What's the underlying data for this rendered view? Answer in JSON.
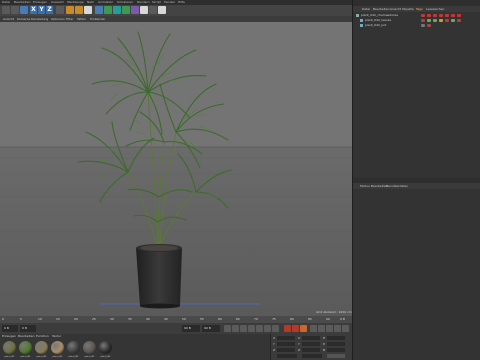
{
  "menu": [
    "Datei",
    "Bearbeiten",
    "Erzeugen",
    "Auswahl",
    "Werkzeuge",
    "Netz",
    "Animation",
    "Simulieren",
    "Rendern",
    "Skript",
    "Fenster",
    "Hilfe"
  ],
  "toolbar": {
    "axis_x": "X",
    "axis_y": "Y",
    "axis_z": "Z"
  },
  "viewport": {
    "menu": [
      "Ansicht",
      "Kameras",
      "Darstellung",
      "Optionen",
      "Filter",
      "Tafeln",
      "ProRender"
    ],
    "label": "Perspektive",
    "grid_info": "Grid Abstand : 1000 cm"
  },
  "object_manager": {
    "menu": [
      "Datei",
      "Bearbeiten",
      "Ansicht",
      "Objekte",
      "Tags",
      "Lesezeichen"
    ],
    "objects": [
      {
        "name": "plant_042_chamaedorea",
        "indent": 0
      },
      {
        "name": "plant_042_leaves",
        "indent": 1
      },
      {
        "name": "plant_042_pot",
        "indent": 1
      }
    ]
  },
  "attribute_manager": {
    "menu": [
      "Modus",
      "Bearbeiten",
      "Benutzerdaten"
    ]
  },
  "timeline": {
    "ticks": [
      "0",
      "5",
      "10",
      "15",
      "20",
      "25",
      "30",
      "35",
      "40",
      "45",
      "50",
      "55",
      "60",
      "65",
      "70",
      "75",
      "80",
      "85",
      "90"
    ],
    "current_frame": "0 B"
  },
  "transport": {
    "start_field": "0 B",
    "frame_field": "0 B",
    "end_field": "90 B",
    "end_field2": "90 B"
  },
  "materials": {
    "menu": [
      "Erzeugen",
      "Bearbeiten",
      "Funktion",
      "Textur"
    ],
    "items": [
      {
        "label": "plant_042",
        "color": "#6f7040"
      },
      {
        "label": "plant_042",
        "color": "#4f7a2a"
      },
      {
        "label": "plant_042",
        "color": "#8c7c56"
      },
      {
        "label": "plant_042",
        "color": "#a98d67"
      },
      {
        "label": "plant_042",
        "color": "#3e3e3e"
      },
      {
        "label": "plant_042",
        "color": "#5b5651"
      },
      {
        "label": "plant_042",
        "color": "#2b2b2b"
      }
    ]
  },
  "coords": {
    "rows": [
      {
        "a": "X",
        "av": "0 cm",
        "b": "X",
        "bv": "0 cm",
        "c": "H",
        "cv": "0 °"
      },
      {
        "a": "Y",
        "av": "0 cm",
        "b": "Y",
        "bv": "0 cm",
        "c": "P",
        "cv": "0 °"
      },
      {
        "a": "Z",
        "av": "0 cm",
        "b": "Z",
        "bv": "0 cm",
        "c": "B",
        "cv": "0 °"
      }
    ],
    "mode1": "Objekt (Rel)",
    "mode2": "Abmessung",
    "apply": "Anwenden"
  },
  "colors": {
    "viewport_bg": "#707070",
    "panel_bg": "#333333",
    "accent_blue": "#4a7bb7",
    "plant_green": "#3f6a2a",
    "pot": "#2b2b2b"
  }
}
